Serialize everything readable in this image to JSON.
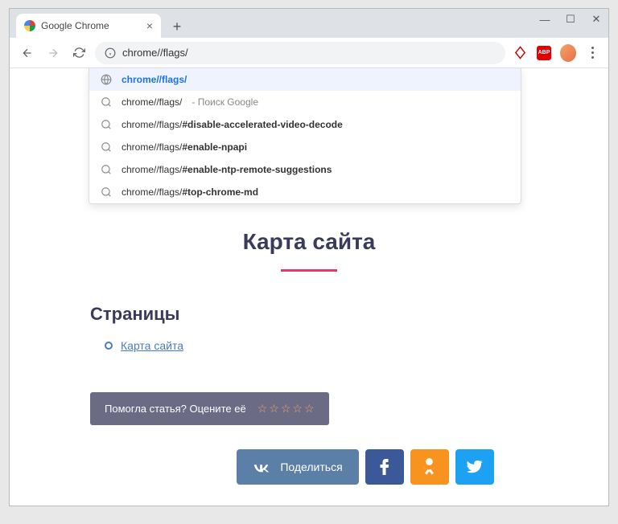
{
  "window": {
    "minimize": "—",
    "maximize": "☐",
    "close": "✕"
  },
  "tab": {
    "title": "Google Chrome",
    "close": "×"
  },
  "newtab": "+",
  "omnibox": {
    "value": "chrome//flags/"
  },
  "ext": {
    "abp": "ABP"
  },
  "suggestions": [
    {
      "text": "chrome//flags/",
      "icon": "globe",
      "active": true
    },
    {
      "prefix": "chrome//flags/",
      "extra": " - Поиск Google",
      "icon": "search"
    },
    {
      "prefix": "chrome//flags/",
      "bold": "#disable-accelerated-video-decode",
      "icon": "search"
    },
    {
      "prefix": "chrome//flags/",
      "bold": "#enable-npapi",
      "icon": "search"
    },
    {
      "prefix": "chrome//flags/",
      "bold": "#enable-ntp-remote-suggestions",
      "icon": "search"
    },
    {
      "prefix": "chrome//flags/",
      "bold": "#top-chrome-md",
      "icon": "search"
    }
  ],
  "page": {
    "title": "Карта сайта",
    "section": "Страницы",
    "link": "Карта сайта",
    "rating_text": "Помогла статья? Оцените её",
    "share_label": "Поделиться"
  }
}
